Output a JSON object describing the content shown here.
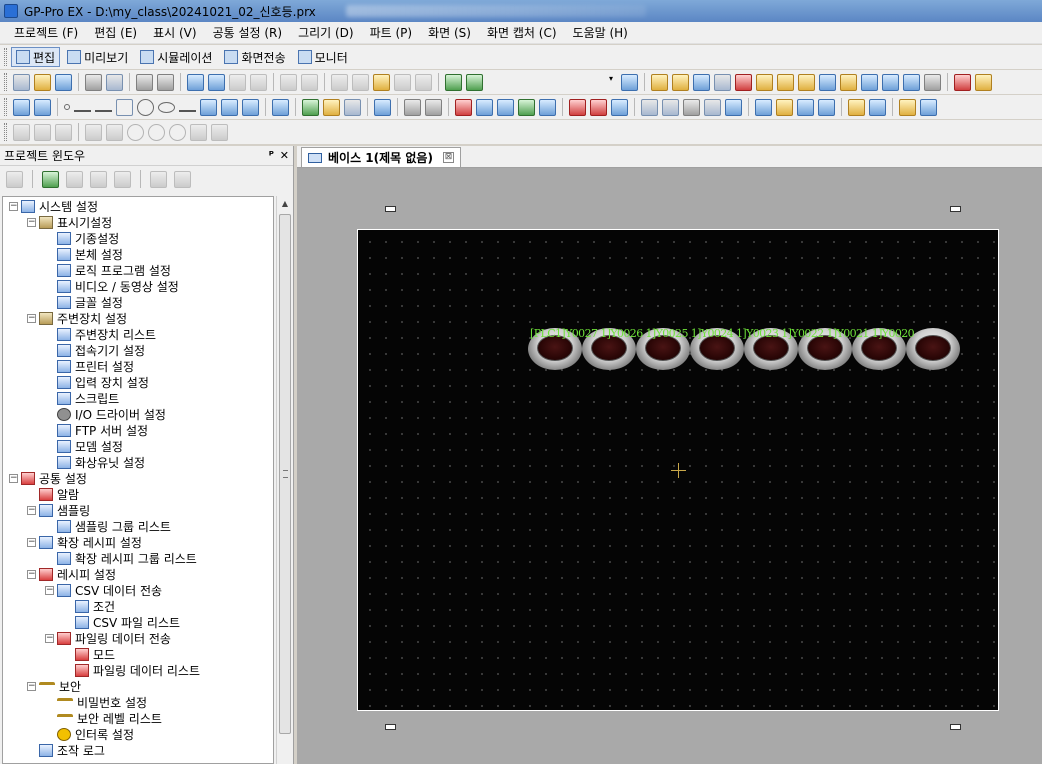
{
  "window": {
    "title": "GP-Pro EX - D:\\my_class\\20241021_02_신호등.prx"
  },
  "menu": [
    "프로젝트 (F)",
    "편집 (E)",
    "표시 (V)",
    "공통 설정 (R)",
    "그리기 (D)",
    "파트 (P)",
    "화면 (S)",
    "화면 캡처 (C)",
    "도움말 (H)"
  ],
  "modes": [
    {
      "label": "편집",
      "active": true
    },
    {
      "label": "미리보기",
      "active": false
    },
    {
      "label": "시뮬레이션",
      "active": false
    },
    {
      "label": "화면전송",
      "active": false
    },
    {
      "label": "모니터",
      "active": false
    }
  ],
  "project_window": {
    "title": "프로젝트 윈도우",
    "pin_label": "ᴾ",
    "close_label": "✕",
    "tree": [
      {
        "label": "시스템 설정",
        "level": 0,
        "expander": "−",
        "icon": "system-settings-icon",
        "cls": ""
      },
      {
        "label": "표시기설정",
        "level": 1,
        "expander": "−",
        "icon": "display-unit-icon",
        "cls": "folder"
      },
      {
        "label": "기종설정",
        "level": 2,
        "icon": "model-icon",
        "cls": ""
      },
      {
        "label": "본체 설정",
        "level": 2,
        "icon": "unit-icon",
        "cls": ""
      },
      {
        "label": "로직 프로그램 설정",
        "level": 2,
        "icon": "logic-icon",
        "cls": ""
      },
      {
        "label": "비디오 / 동영상 설정",
        "level": 2,
        "icon": "video-icon",
        "cls": ""
      },
      {
        "label": "글꼴 설정",
        "level": 2,
        "icon": "font-icon",
        "cls": ""
      },
      {
        "label": "주변장치 설정",
        "level": 1,
        "expander": "−",
        "icon": "peripheral-icon",
        "cls": "folder"
      },
      {
        "label": "주변장치 리스트",
        "level": 2,
        "icon": "peripheral-list-icon",
        "cls": ""
      },
      {
        "label": "접속기기 설정",
        "level": 2,
        "icon": "device-icon",
        "cls": ""
      },
      {
        "label": "프린터 설정",
        "level": 2,
        "icon": "printer-icon",
        "cls": ""
      },
      {
        "label": "입력 장치 설정",
        "level": 2,
        "icon": "input-device-icon",
        "cls": ""
      },
      {
        "label": "스크립트",
        "level": 2,
        "icon": "script-icon",
        "cls": ""
      },
      {
        "label": "I/O 드라이버 설정",
        "level": 2,
        "icon": "io-driver-icon",
        "cls": "gear"
      },
      {
        "label": "FTP 서버 설정",
        "level": 2,
        "icon": "ftp-icon",
        "cls": ""
      },
      {
        "label": "모뎀 설정",
        "level": 2,
        "icon": "modem-icon",
        "cls": ""
      },
      {
        "label": "화상유닛 설정",
        "level": 2,
        "icon": "image-unit-icon",
        "cls": ""
      },
      {
        "label": "공통 설정",
        "level": 0,
        "expander": "−",
        "icon": "common-settings-icon",
        "cls": "red"
      },
      {
        "label": "알람",
        "level": 1,
        "icon": "alarm-icon",
        "cls": "red"
      },
      {
        "label": "샘플링",
        "level": 1,
        "expander": "−",
        "icon": "sampling-icon",
        "cls": ""
      },
      {
        "label": "샘플링 그룹 리스트",
        "level": 2,
        "icon": "sampling-group-icon",
        "cls": ""
      },
      {
        "label": "확장 레시피 설정",
        "level": 1,
        "expander": "−",
        "icon": "ext-recipe-icon",
        "cls": ""
      },
      {
        "label": "확장 레시피 그룹 리스트",
        "level": 2,
        "icon": "ext-recipe-group-icon",
        "cls": ""
      },
      {
        "label": "레시피 설정",
        "level": 1,
        "expander": "−",
        "icon": "recipe-icon",
        "cls": "red"
      },
      {
        "label": "CSV 데이터 전송",
        "level": 2,
        "expander": "−",
        "icon": "csv-icon",
        "cls": ""
      },
      {
        "label": "조건",
        "level": 3,
        "icon": "condition-icon",
        "cls": ""
      },
      {
        "label": "CSV 파일 리스트",
        "level": 3,
        "icon": "csv-file-icon",
        "cls": ""
      },
      {
        "label": "파일링 데이터 전송",
        "level": 2,
        "expander": "−",
        "icon": "filing-icon",
        "cls": "red"
      },
      {
        "label": "모드",
        "level": 3,
        "icon": "mode-icon",
        "cls": "red"
      },
      {
        "label": "파일링 데이터 리스트",
        "level": 3,
        "icon": "filing-list-icon",
        "cls": "red"
      },
      {
        "label": "보안",
        "level": 1,
        "expander": "−",
        "icon": "security-key-icon",
        "cls": "key"
      },
      {
        "label": "비밀번호 설정",
        "level": 2,
        "icon": "password-key-icon",
        "cls": "key"
      },
      {
        "label": "보안 레벨 리스트",
        "level": 2,
        "icon": "level-key-icon",
        "cls": "key"
      },
      {
        "label": "인터록 설정",
        "level": 2,
        "icon": "interlock-icon",
        "cls": "warn"
      },
      {
        "label": "조작 로그",
        "level": 1,
        "icon": "operation-log-icon",
        "cls": ""
      }
    ]
  },
  "editor": {
    "tab_label": "베이스 1(제목 없음)",
    "tab_close": "⊠",
    "lamp_label": "[PLC1]Y0027 1]Y0026 1]Y0025 1]Y0024 1]Y0023 1]Y0022 1]Y0021 1]Y0020",
    "lamp_count": 8
  },
  "colors": {
    "lamp_label": "#6fe33a",
    "screen_bg": "#050505",
    "workspace_bg": "#a9a9a9"
  }
}
